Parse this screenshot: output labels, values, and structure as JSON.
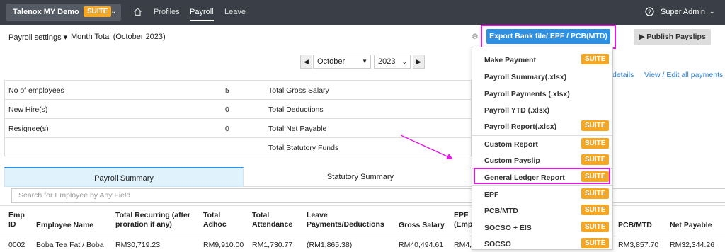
{
  "topbar": {
    "company": "Talenox MY Demo",
    "suite_badge": "SUITE",
    "nav": [
      "Profiles",
      "Payroll",
      "Leave"
    ],
    "user": "Super Admin"
  },
  "subbar": {
    "payroll_settings": "Payroll settings",
    "month_total": "Month Total (October 2023)",
    "export_label": "Export Bank file/ EPF / PCB(MTD)",
    "publish_label": "Publish Payslips"
  },
  "period": {
    "month": "October",
    "year": "2023"
  },
  "summary": {
    "rows": [
      {
        "label": "No of employees",
        "count": "5",
        "total_label": "Total Gross Salary"
      },
      {
        "label": "New Hire(s)",
        "count": "0",
        "total_label": "Total Deductions"
      },
      {
        "label": "Resignee(s)",
        "count": "0",
        "total_label": "Total Net Payable"
      },
      {
        "label": "",
        "count": "",
        "total_label": "Total Statutory Funds"
      }
    ]
  },
  "links": {
    "details": "details",
    "view_all": "View / Edit all payments"
  },
  "tabs": [
    "Payroll Summary",
    "Statutory Summary"
  ],
  "search_placeholder": "Search for Employee by Any Field",
  "table": {
    "headers": [
      "Emp ID",
      "Employee Name",
      "Total Recurring (after proration if any)",
      "Total Adhoc",
      "Total Attendance",
      "Leave Payments/Deductions",
      "Gross Salary",
      "EPF (Emp",
      "PCB/MTD",
      "Net Payable"
    ],
    "row": [
      "0002",
      "Boba Tea Fat / Boba",
      "RM30,719.23",
      "RM9,910.00",
      "RM1,730.77",
      "(RM1,865.38)",
      "RM40,494.61",
      "RM4,",
      "RM3,857.70",
      "RM32,344.26"
    ]
  },
  "menu": {
    "items": [
      {
        "label": "Make Payment",
        "badge": "SUITE"
      },
      {
        "label": "Payroll Summary(.xlsx)",
        "badge": ""
      },
      {
        "label": "Payroll Payments (.xlsx)",
        "badge": ""
      },
      {
        "label": "Payroll YTD (.xlsx)",
        "badge": ""
      },
      {
        "label": "Payroll Report(.xlsx)",
        "badge": "SUITE"
      },
      {
        "label": "Custom Report",
        "badge": "SUITE"
      },
      {
        "label": "Custom Payslip",
        "badge": "SUITE"
      },
      {
        "label": "General Ledger Report",
        "badge": "SUITE"
      },
      {
        "label": "EPF",
        "badge": "SUITE"
      },
      {
        "label": "PCB/MTD",
        "badge": "SUITE"
      },
      {
        "label": "SOCSO + EIS",
        "badge": "SUITE"
      },
      {
        "label": "SOCSO",
        "badge": "SUITE"
      }
    ]
  },
  "colors": {
    "accent": "#2f8fe0",
    "suite": "#f5a623",
    "highlight": "#e01be0",
    "topbar": "#3a3f47"
  }
}
